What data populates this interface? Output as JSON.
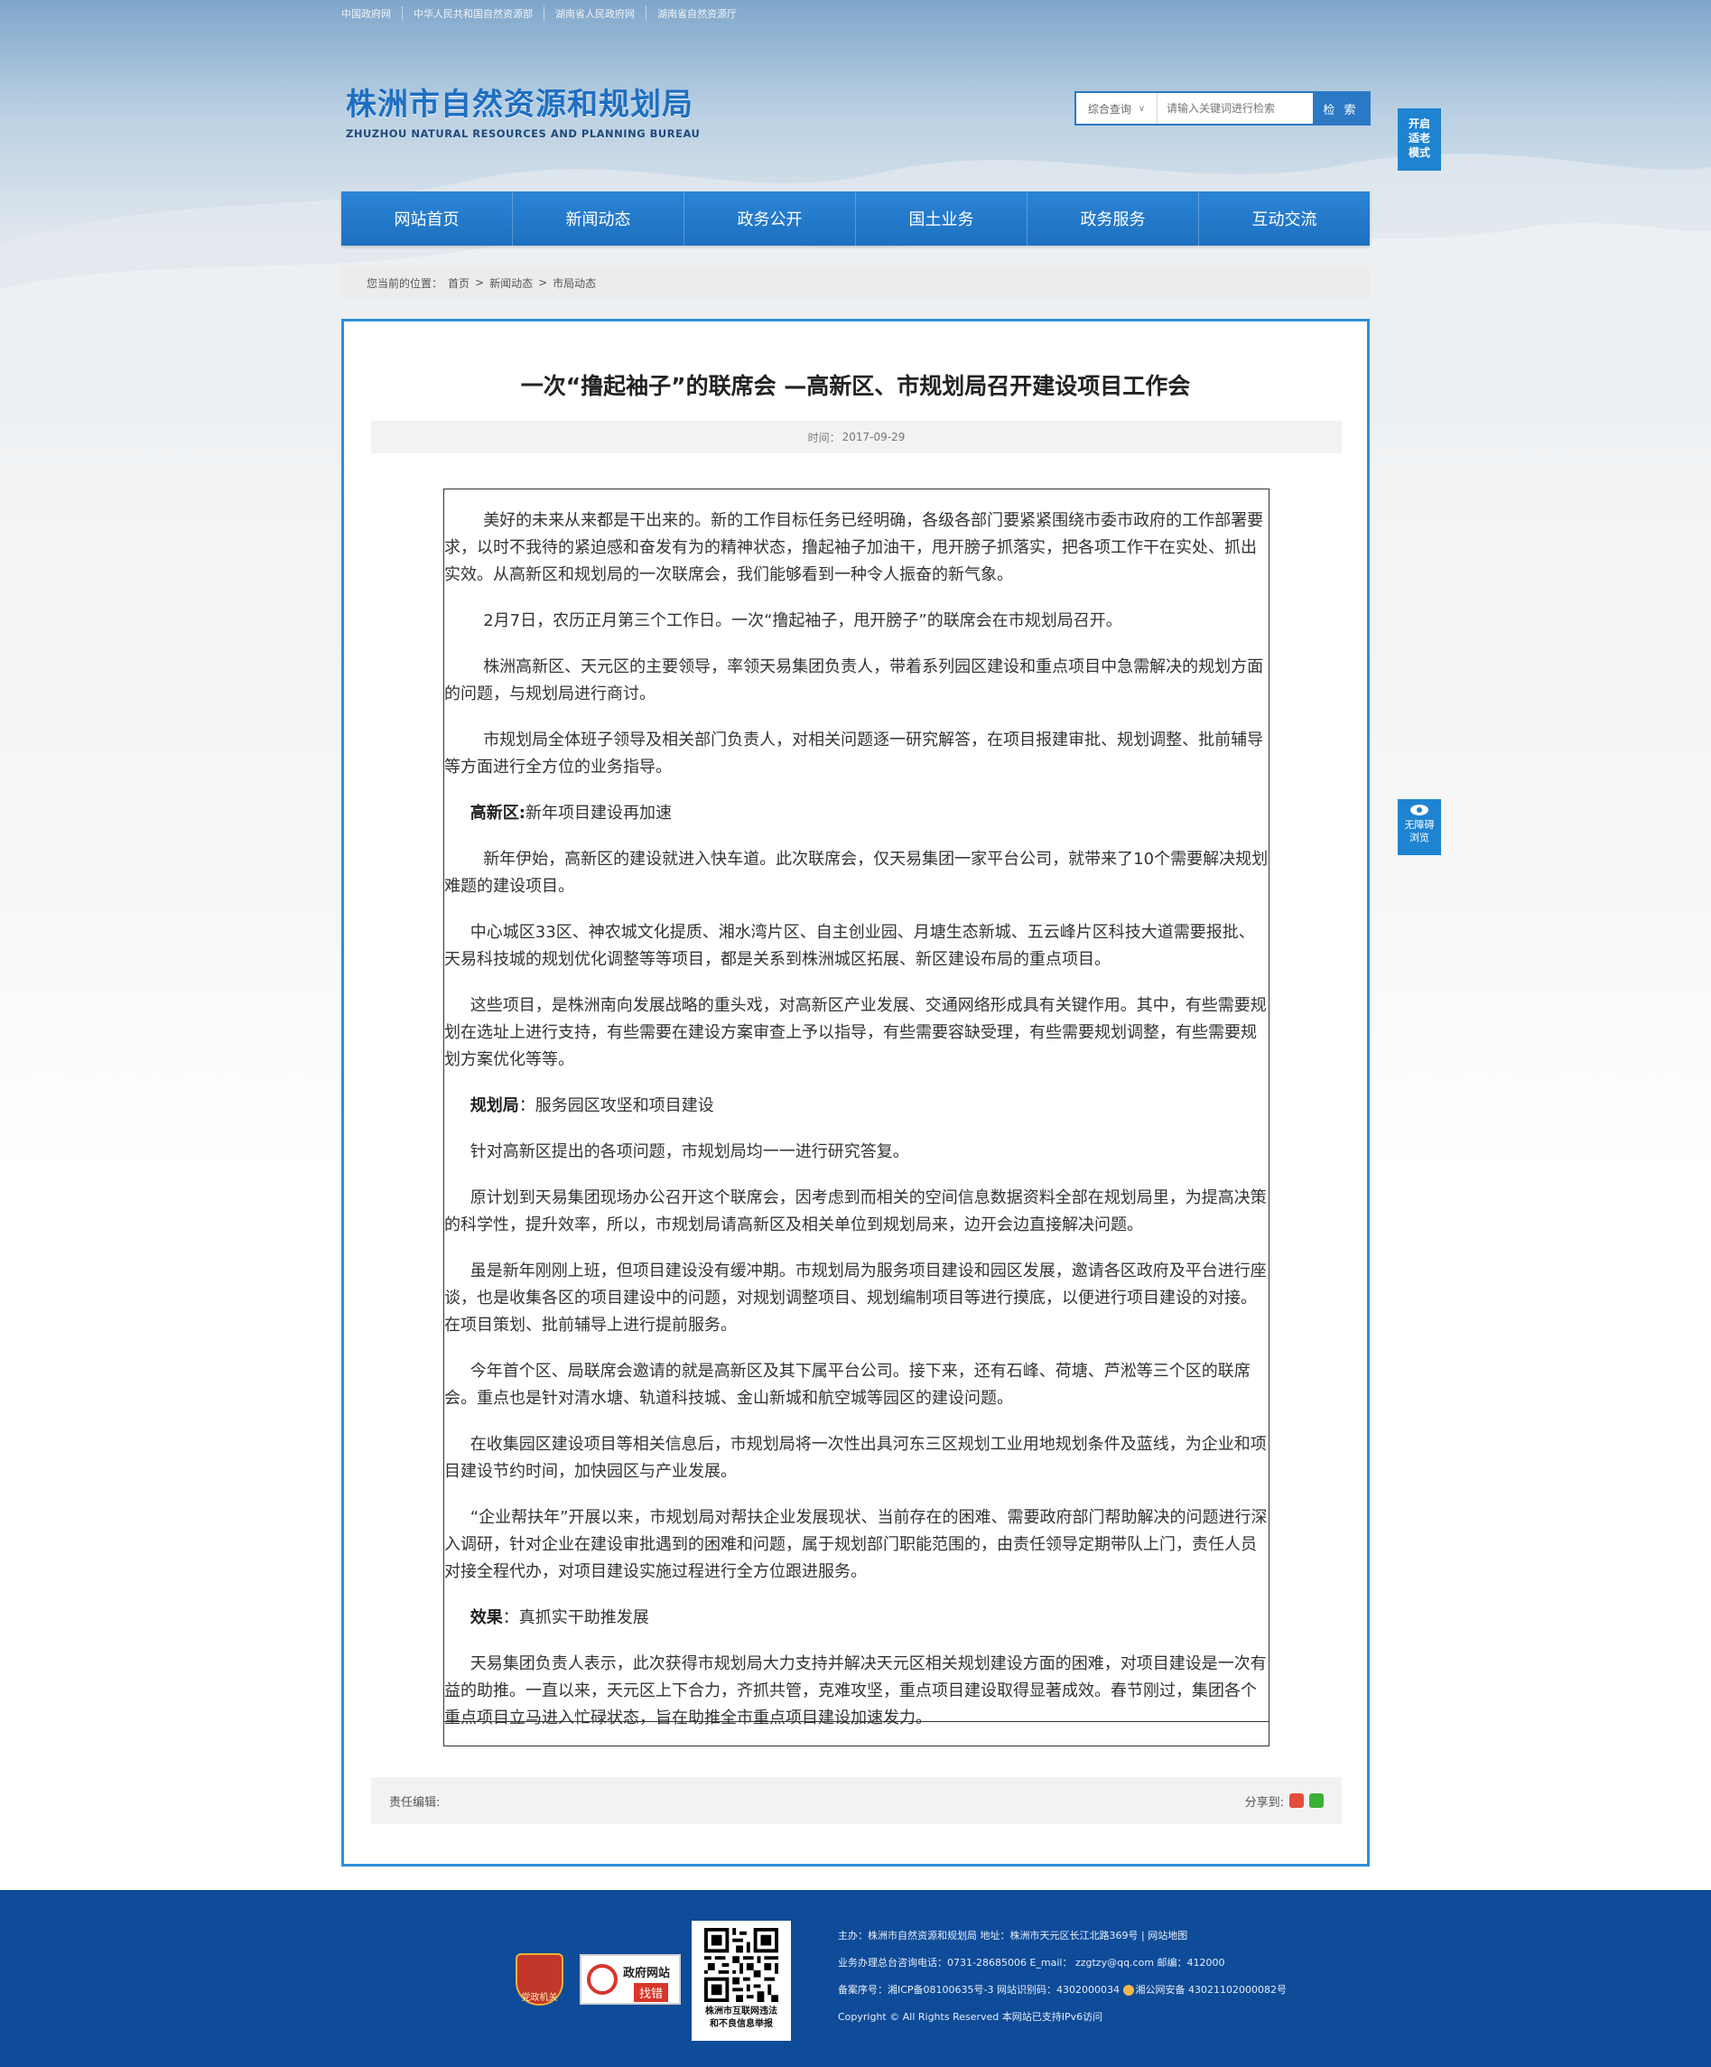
{
  "top_links": [
    "中国政府网",
    "中华人民共和国自然资源部",
    "湖南省人民政府网",
    "湖南省自然资源厅"
  ],
  "site": {
    "name_cn": "株洲市自然资源和规划局",
    "name_en": "ZHUZHOU NATURAL RESOURCES AND PLANNING BUREAU"
  },
  "search": {
    "scope": "综合查询",
    "placeholder": "请输入关键词进行检索",
    "button": "检 索"
  },
  "elder_mode": [
    "开启",
    "适老",
    "模式"
  ],
  "accessibility": [
    "无障碍",
    "浏览"
  ],
  "nav": [
    "网站首页",
    "新闻动态",
    "政务公开",
    "国土业务",
    "政务服务",
    "互动交流"
  ],
  "breadcrumb": {
    "prefix": "您当前的位置：",
    "items": [
      "首页",
      "新闻动态",
      "市局动态"
    ],
    "sep": ">"
  },
  "article": {
    "title": "一次“撸起袖子”的联席会 —高新区、市规划局召开建设项目工作会",
    "date_label": "时间：",
    "date": "2017-09-29",
    "paragraphs": [
      "美好的未来从来都是干出来的。新的工作目标任务已经明确，各级各部门要紧紧围绕市委市政府的工作部署要求，以时不我待的紧迫感和奋发有为的精神状态，撸起袖子加油干，甩开膀子抓落实，把各项工作干在实处、抓出实效。从高新区和规划局的一次联席会，我们能够看到一种令人振奋的新气象。",
      "2月7日，农历正月第三个工作日。一次“撸起袖子，甩开膀子”的联席会在市规划局召开。",
      "株洲高新区、天元区的主要领导，率领天易集团负责人，带着系列园区建设和重点项目中急需解决的规划方面的问题，与规划局进行商讨。",
      "市规划局全体班子领导及相关部门负责人，对相关问题逐一研究解答，在项目报建审批、规划调整、批前辅导等方面进行全方位的业务指导。"
    ],
    "section1": {
      "label": "高新区:",
      "text": "新年项目建设再加速"
    },
    "paragraphs2": [
      "新年伊始，高新区的建设就进入快车道。此次联席会，仅天易集团一家平台公司，就带来了10个需要解决规划难题的建设项目。",
      "中心城区33区、神农城文化提质、湘水湾片区、自主创业园、月塘生态新城、五云峰片区科技大道需要报批、天易科技城的规划优化调整等等项目，都是关系到株洲城区拓展、新区建设布局的重点项目。",
      "这些项目，是株洲南向发展战略的重头戏，对高新区产业发展、交通网络形成具有关键作用。其中，有些需要规划在选址上进行支持，有些需要在建设方案审查上予以指导，有些需要容缺受理，有些需要规划调整，有些需要规划方案优化等等。"
    ],
    "section2": {
      "label": "规划局",
      "text": "：服务园区攻坚和项目建设"
    },
    "paragraphs3": [
      "针对高新区提出的各项问题，市规划局均一一进行研究答复。",
      "原计划到天易集团现场办公召开这个联席会，因考虑到而相关的空间信息数据资料全部在规划局里，为提高决策的科学性，提升效率，所以，市规划局请高新区及相关单位到规划局来，边开会边直接解决问题。",
      "虽是新年刚刚上班，但项目建设没有缓冲期。市规划局为服务项目建设和园区发展，邀请各区政府及平台进行座谈，也是收集各区的项目建设中的问题，对规划调整项目、规划编制项目等进行摸底，以便进行项目建设的对接。在项目策划、批前辅导上进行提前服务。",
      "今年首个区、局联席会邀请的就是高新区及其下属平台公司。接下来，还有石峰、荷塘、芦淞等三个区的联席会。重点也是针对清水塘、轨道科技城、金山新城和航空城等园区的建设问题。",
      "在收集园区建设项目等相关信息后，市规划局将一次性出具河东三区规划工业用地规划条件及蓝线，为企业和项目建设节约时间，加快园区与产业发展。",
      "“企业帮扶年”开展以来，市规划局对帮扶企业发展现状、当前存在的困难、需要政府部门帮助解决的问题进行深入调研，针对企业在建设审批遇到的困难和问题，属于规划部门职能范围的，由责任领导定期带队上门，责任人员对接全程代办，对项目建设实施过程进行全方位跟进服务。"
    ],
    "section3": {
      "label": "效果",
      "text": "：真抓实干助推发展"
    },
    "paragraphs4": [
      "天易集团负责人表示，此次获得市规划局大力支持并解决天元区相关规划建设方面的困难，对项目建设是一次有益的助推。一直以来，天元区上下合力，齐抓共管，克难攻坚，重点项目建设取得显著成效。春节刚过，集团各个重点项目立马进入忙碌状态，旨在助推全市重点项目建设加速发力。"
    ],
    "editor_label": "责任编辑:",
    "share_label": "分享到:"
  },
  "footer": {
    "badge1_text": "党政机关",
    "badge2_title": "政府网站",
    "badge2_action": "找错",
    "qr_caption_1": "株洲市互联网违法",
    "qr_caption_2": "和不良信息举报",
    "lines": [
      "主办：株洲市自然资源和规划局  地址：株洲市天元区长江北路369号 | 网站地图",
      "业务办理总台咨询电话：0731-28685006   E_mail：  zzgtzy@qq.com    邮编：412000",
      "备案序号：湘ICP备08100635号-3 网站识别码：4302000034",
      "Copyright © All Rights Reserved 本网站已支持IPv6访问"
    ],
    "police": "湘公网安备 43021102000082号"
  }
}
